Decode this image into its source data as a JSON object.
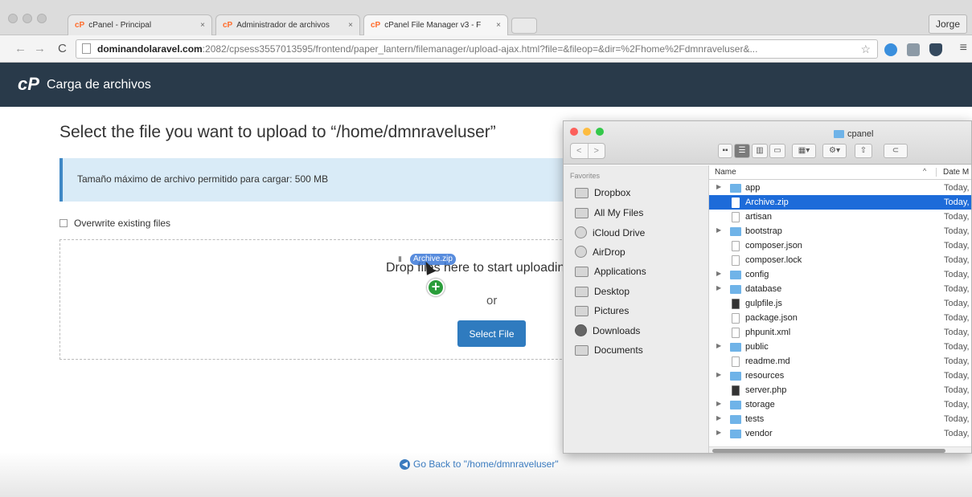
{
  "browser": {
    "tabs": [
      {
        "label": "cPanel - Principal",
        "icon": "cp"
      },
      {
        "label": "Administrador de archivos",
        "icon": "cp"
      },
      {
        "label": "cPanel File Manager v3 - F",
        "icon": "cp"
      }
    ],
    "tab_close": "×",
    "user": "Jorge",
    "url_host": "dominandolaravel.com",
    "url_rest": ":2082/cpsess3557013595/frontend/paper_lantern/filemanager/upload-ajax.html?file=&fileop=&dir=%2Fhome%2Fdmnraveluser&...",
    "back_glyph": "←",
    "forward_glyph": "→",
    "reload_glyph": "C",
    "star_glyph": "☆",
    "menu_glyph": "≡"
  },
  "cpanel": {
    "logo": "cP",
    "title": "Carga de archivos"
  },
  "upload": {
    "heading": "Select the file you want to upload to “/home/dmnraveluser”",
    "max_size": "Tamaño máximo de archivo permitido para cargar: 500 MB",
    "overwrite_label": "Overwrite existing files",
    "drop_text": "Drop files here to start uploading",
    "or_text": "or",
    "select_button": "Select File",
    "drag_file": "Archive.zip",
    "plus_glyph": "+",
    "go_back": "Go Back to \"/home/dmnraveluser\"",
    "go_back_glyph": "◀"
  },
  "finder": {
    "title": "cpanel",
    "nav_back": "<",
    "nav_forward": ">",
    "sidebar_heading": "Favorites",
    "favorites": [
      {
        "label": "Dropbox",
        "icon": "folder-icon"
      },
      {
        "label": "All My Files",
        "icon": "all-files-icon"
      },
      {
        "label": "iCloud Drive",
        "icon": "cloud-icon"
      },
      {
        "label": "AirDrop",
        "icon": "airdrop-icon"
      },
      {
        "label": "Applications",
        "icon": "applications-icon"
      },
      {
        "label": "Desktop",
        "icon": "desktop-icon"
      },
      {
        "label": "Pictures",
        "icon": "camera-icon"
      },
      {
        "label": "Downloads",
        "icon": "download-icon"
      },
      {
        "label": "Documents",
        "icon": "documents-icon"
      }
    ],
    "col_name": "Name",
    "col_date": "Date M",
    "sort_glyph": "^",
    "disclosure_glyph": "▶",
    "files": [
      {
        "name": "app",
        "type": "folder",
        "date": "Today,"
      },
      {
        "name": "Archive.zip",
        "type": "zip",
        "date": "Today,",
        "selected": true
      },
      {
        "name": "artisan",
        "type": "file",
        "date": "Today,"
      },
      {
        "name": "bootstrap",
        "type": "folder",
        "date": "Today,"
      },
      {
        "name": "composer.json",
        "type": "file",
        "date": "Today,"
      },
      {
        "name": "composer.lock",
        "type": "file",
        "date": "Today,"
      },
      {
        "name": "config",
        "type": "folder",
        "date": "Today,"
      },
      {
        "name": "database",
        "type": "folder",
        "date": "Today,"
      },
      {
        "name": "gulpfile.js",
        "type": "php",
        "date": "Today,"
      },
      {
        "name": "package.json",
        "type": "file",
        "date": "Today,"
      },
      {
        "name": "phpunit.xml",
        "type": "file",
        "date": "Today,"
      },
      {
        "name": "public",
        "type": "folder",
        "date": "Today,"
      },
      {
        "name": "readme.md",
        "type": "file",
        "date": "Today,"
      },
      {
        "name": "resources",
        "type": "folder",
        "date": "Today,"
      },
      {
        "name": "server.php",
        "type": "php",
        "date": "Today,"
      },
      {
        "name": "storage",
        "type": "folder",
        "date": "Today,"
      },
      {
        "name": "tests",
        "type": "folder",
        "date": "Today,"
      },
      {
        "name": "vendor",
        "type": "folder",
        "date": "Today,"
      }
    ]
  },
  "colors": {
    "cpanel_header": "#293a4a",
    "accent_blue": "#2f7bbf",
    "selection": "#1d6bd9",
    "folder": "#6fb3e8"
  }
}
